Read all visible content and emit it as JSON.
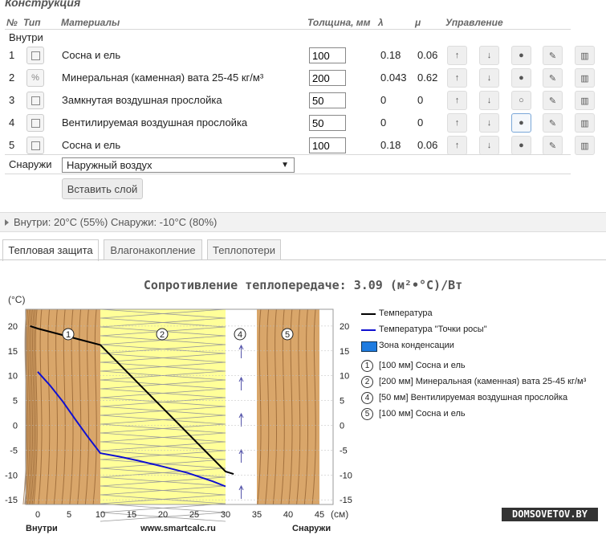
{
  "section_title": "Конструкция",
  "headers": {
    "num": "№",
    "type": "Тип",
    "materials": "Материалы",
    "thickness": "Толщина, мм",
    "lambda": "λ",
    "mu": "μ",
    "control": "Управление"
  },
  "inside_label": "Внутри",
  "outside_label": "Снаружи",
  "layers": [
    {
      "num": "1",
      "type_icon": "square-icon",
      "name": "Сосна и ель",
      "thickness": "100",
      "lambda": "0.18",
      "mu": "0.06",
      "dot": "filled"
    },
    {
      "num": "2",
      "type_icon": "percent-icon",
      "name": "Минеральная (каменная) вата 25-45 кг/м³",
      "thickness": "200",
      "lambda": "0.043",
      "mu": "0.62",
      "dot": "filled"
    },
    {
      "num": "3",
      "type_icon": "square-icon",
      "name": "Замкнутая воздушная прослойка",
      "thickness": "50",
      "lambda": "0",
      "mu": "0",
      "dot": "empty"
    },
    {
      "num": "4",
      "type_icon": "square-icon",
      "name": "Вентилируемая воздушная прослойка",
      "thickness": "50",
      "lambda": "0",
      "mu": "0",
      "dot": "filled"
    },
    {
      "num": "5",
      "type_icon": "square-icon",
      "name": "Сосна и ель",
      "thickness": "100",
      "lambda": "0.18",
      "mu": "0.06",
      "dot": "filled"
    }
  ],
  "outside_select": "Наружный воздух",
  "insert_button": "Вставить слой",
  "climate_summary": "Внутри: 20°C (55%) Снаружи: -10°C (80%)",
  "tabs": [
    "Тепловая защита",
    "Влагонакопление",
    "Теплопотери"
  ],
  "selected_tab": "Тепловая защита",
  "chart_title": "Сопротивление теплопередаче: 3.09 (м²•°С)/Вт",
  "chart_data": {
    "type": "line",
    "ylabel": "(°С)",
    "xlabel": "(см)",
    "x_ticks": [
      "0",
      "5",
      "10",
      "15",
      "20",
      "25",
      "30",
      "35",
      "40",
      "45"
    ],
    "y_ticks": [
      "20",
      "15",
      "10",
      "5",
      "0",
      "-5",
      "-10",
      "-15"
    ],
    "xlim": [
      -2,
      45
    ],
    "ylim": [
      -15.5,
      22
    ],
    "bottom_labels": {
      "left": "Внутри",
      "center": "www.smartcalc.ru",
      "right": "Снаружи"
    },
    "layers": [
      {
        "label": "1",
        "from": 0,
        "to": 10,
        "kind": "wood"
      },
      {
        "label": "2",
        "from": 10,
        "to": 30,
        "kind": "wool"
      },
      {
        "label": "4",
        "from": 30,
        "to": 35,
        "kind": "air"
      },
      {
        "label": "5",
        "from": 35,
        "to": 45,
        "kind": "wood"
      }
    ],
    "series": [
      {
        "name": "Температура",
        "color": "#000000",
        "x": [
          -1.2,
          0,
          10,
          30,
          31.3
        ],
        "y": [
          20,
          19.5,
          16.2,
          -9.3,
          -9.8
        ]
      },
      {
        "name": "Температура \"Точки росы\"",
        "color": "#1010d0",
        "x": [
          0,
          2,
          4,
          6,
          8,
          10,
          13,
          16,
          20,
          24,
          28,
          30
        ],
        "y": [
          10.8,
          8,
          4.8,
          1.2,
          -2.3,
          -5.6,
          -6.3,
          -7.1,
          -8.3,
          -9.6,
          -11.3,
          -12.3
        ]
      }
    ],
    "legend": {
      "temperature": "Температура",
      "dewpoint": "Температура \"Точки росы\"",
      "condensation": "Зона конденсации",
      "layer1": "[100 мм] Сосна и ель",
      "layer2": "[200 мм] Минеральная (каменная) вата 25-45 кг/м³",
      "layer4": "[50 мм] Вентилируемая воздушная прослойка",
      "layer5": "[100 мм] Сосна и ель"
    },
    "legend_nums": {
      "l1": "1",
      "l2": "2",
      "l4": "4",
      "l5": "5"
    }
  },
  "watermark": "DOMSOVETOV.BY"
}
